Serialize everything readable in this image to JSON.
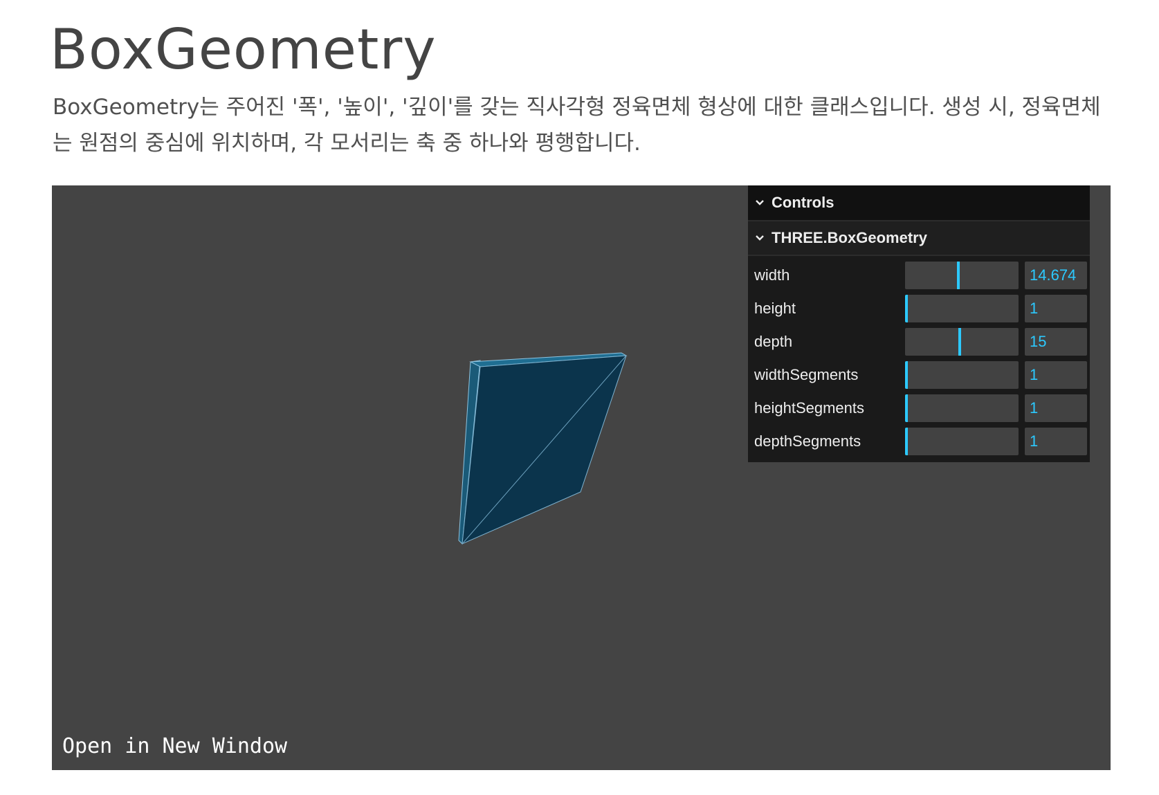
{
  "page": {
    "title": "BoxGeometry",
    "description": "BoxGeometry는 주어진 '폭', '높이', '깊이'를 갖는 직사각형 정육면체 형상에 대한 클래스입니다. 생성 시, 정육면체는 원점의 중심에 위치하며, 각 모서리는 축 중 하나와 평행합니다."
  },
  "viewport": {
    "open_link": "Open in New Window",
    "background": "#444444",
    "mesh_color": "#0b344c",
    "edge_color": "#7fb3d0"
  },
  "gui": {
    "header": "Controls",
    "folder": "THREE.BoxGeometry",
    "accent": "#2cc9ff",
    "params": [
      {
        "label": "width",
        "value": "14.674",
        "fraction": 0.47
      },
      {
        "label": "height",
        "value": "1",
        "fraction": 0.0
      },
      {
        "label": "depth",
        "value": "15",
        "fraction": 0.48
      },
      {
        "label": "widthSegments",
        "value": "1",
        "fraction": 0.0
      },
      {
        "label": "heightSegments",
        "value": "1",
        "fraction": 0.0
      },
      {
        "label": "depthSegments",
        "value": "1",
        "fraction": 0.0
      }
    ]
  }
}
